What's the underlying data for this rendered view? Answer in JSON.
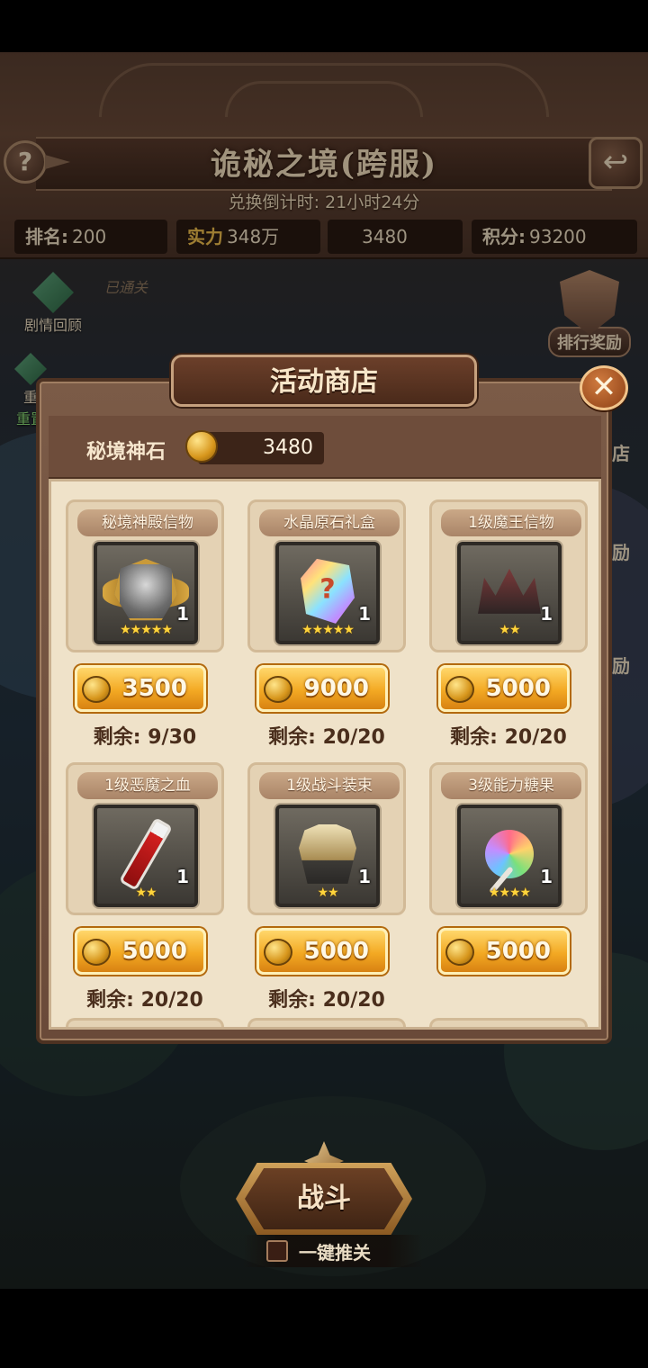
{
  "header": {
    "title": "诡秘之境(跨服)",
    "countdown": "兑换倒计时: 21小时24分",
    "help_glyph": "?",
    "back_glyph": "↩"
  },
  "stats": {
    "rank_label": "排名:",
    "rank_value": "200",
    "power_label": "实力",
    "power_value": "348万",
    "stone_value": "3480",
    "score_label": "积分:",
    "score_value": "93200"
  },
  "side": {
    "story_review": "剧情回顾",
    "reset_partial": "重",
    "reset": "重置",
    "rank_reward": "排行奖励",
    "stamp": "已通关",
    "right_partial_1": "店",
    "right_partial_2": "励",
    "right_partial_3": "励"
  },
  "shop": {
    "title": "活动商店",
    "close_glyph": "✕",
    "currency_label": "秘境神石",
    "currency_value": "3480",
    "items": [
      {
        "name": "秘境神殿信物",
        "count": "1",
        "stars": "★★★★★",
        "price": "3500",
        "remaining": "剩余: 9/30",
        "icon": "temple-crest-icon"
      },
      {
        "name": "水晶原石礼盒",
        "count": "1",
        "stars": "★★★★★",
        "price": "9000",
        "remaining": "剩余: 20/20",
        "icon": "crystal-gift-icon"
      },
      {
        "name": "1级魔王信物",
        "count": "1",
        "stars": "★★",
        "price": "5000",
        "remaining": "剩余: 20/20",
        "icon": "demon-crown-icon"
      },
      {
        "name": "1级恶魔之血",
        "count": "1",
        "stars": "★★",
        "price": "5000",
        "remaining": "剩余: 20/20",
        "icon": "blood-vial-icon"
      },
      {
        "name": "1级战斗装束",
        "count": "1",
        "stars": "★★",
        "price": "5000",
        "remaining": "剩余: 20/20",
        "icon": "battle-armor-icon"
      },
      {
        "name": "3级能力糖果",
        "count": "1",
        "stars": "★★★★",
        "price": "5000",
        "remaining": "",
        "icon": "candy-icon"
      }
    ]
  },
  "bottom": {
    "battle_label": "战斗",
    "auto_label": "一键推关"
  },
  "colors": {
    "accent_gold": "#f3a923",
    "panel_bg": "#efe2c9",
    "frame_brown": "#6a4a39"
  }
}
